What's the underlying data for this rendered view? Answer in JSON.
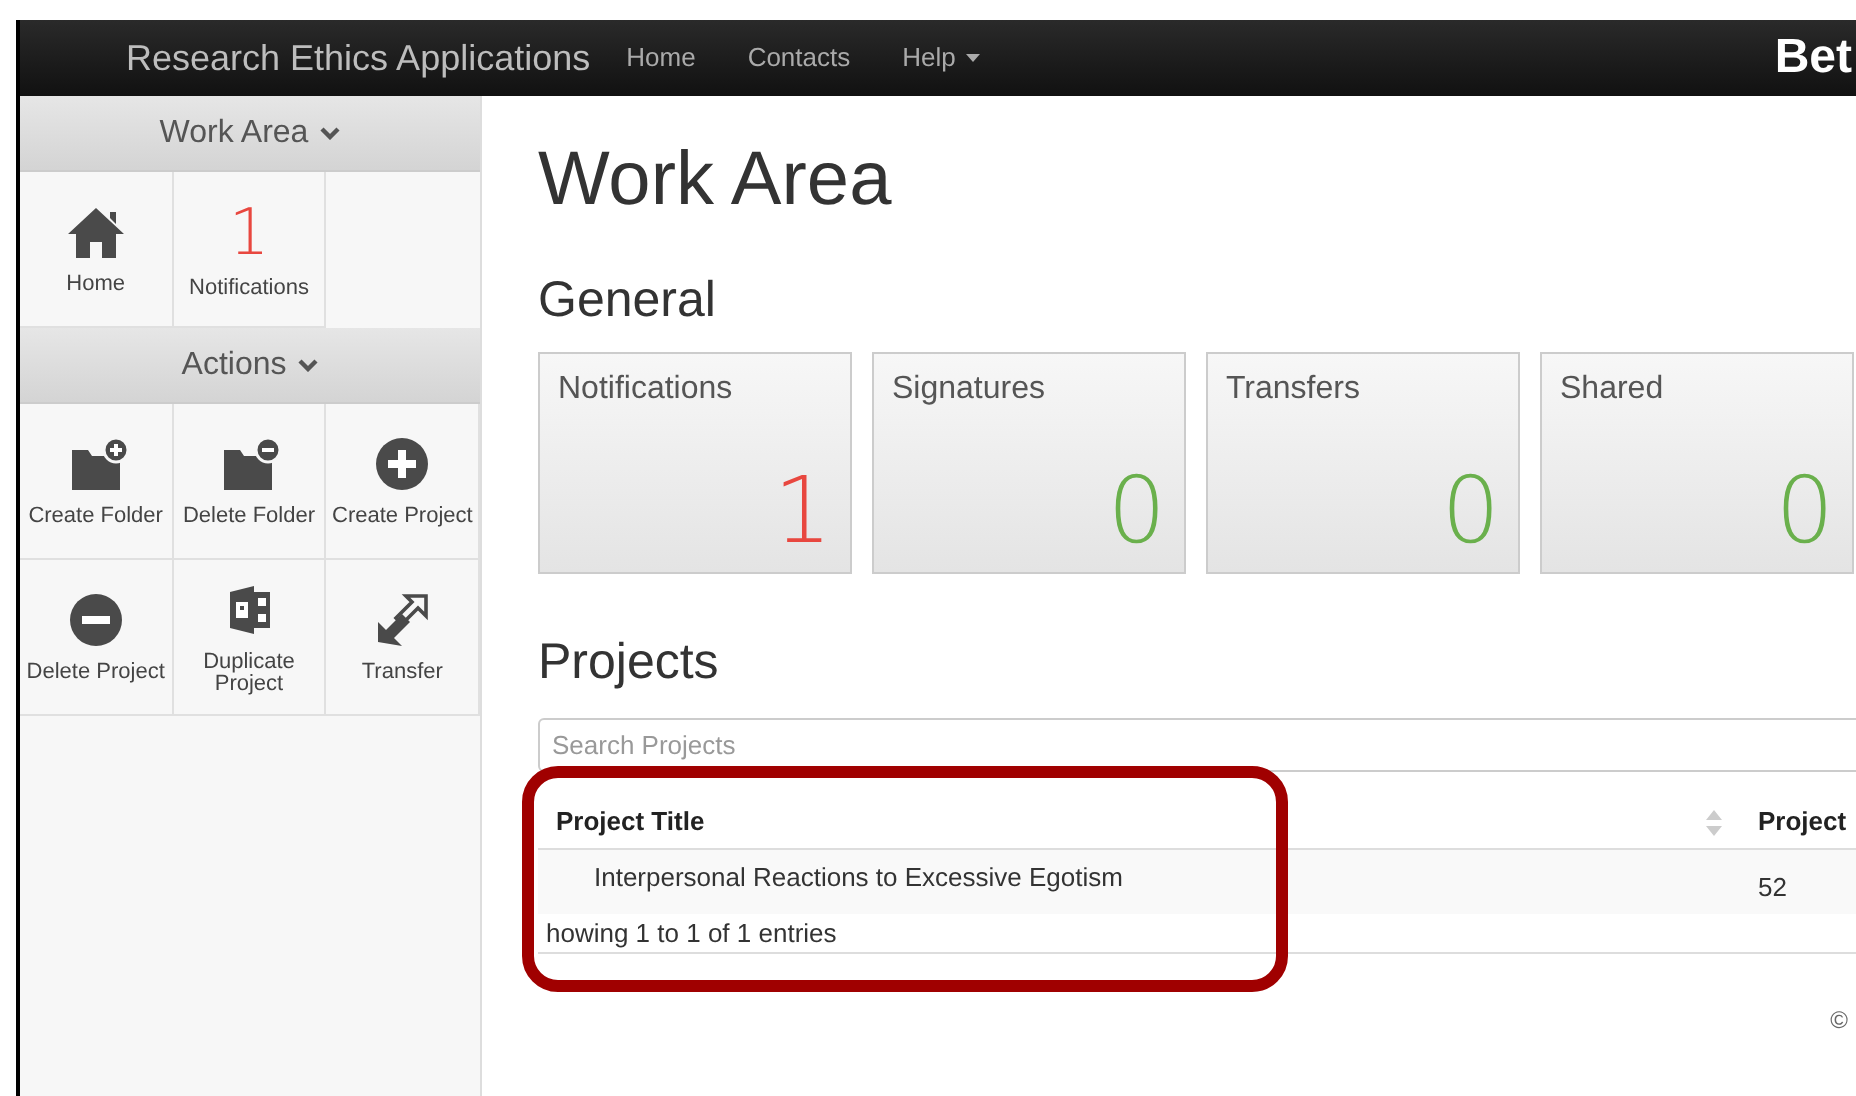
{
  "navbar": {
    "brand": "Research Ethics Applications",
    "links": [
      {
        "label": "Home",
        "dropdown": false
      },
      {
        "label": "Contacts",
        "dropdown": false
      },
      {
        "label": "Help",
        "dropdown": true
      }
    ],
    "right_text": "Bet"
  },
  "sidebar": {
    "sections": [
      {
        "title": "Work Area",
        "tiles": [
          {
            "kind": "icon",
            "label": "Home"
          },
          {
            "kind": "count",
            "count": "1",
            "label": "Notifications"
          }
        ]
      },
      {
        "title": "Actions",
        "tiles": [
          {
            "kind": "icon",
            "label": "Create Folder"
          },
          {
            "kind": "icon",
            "label": "Delete Folder"
          },
          {
            "kind": "icon",
            "label": "Create Project"
          },
          {
            "kind": "icon",
            "label": "Delete Project"
          },
          {
            "kind": "icon",
            "label": "Duplicate Project"
          },
          {
            "kind": "icon",
            "label": "Transfer"
          }
        ]
      }
    ]
  },
  "page_title": "Work Area",
  "general": {
    "title": "General",
    "cards": [
      {
        "title": "Notifications",
        "value": "1",
        "color": "#e8473f"
      },
      {
        "title": "Signatures",
        "value": "0",
        "color": "#6ab04c"
      },
      {
        "title": "Transfers",
        "value": "0",
        "color": "#6ab04c"
      },
      {
        "title": "Shared",
        "value": "0",
        "color": "#6ab04c"
      }
    ]
  },
  "projects": {
    "title": "Projects",
    "search": {
      "placeholder": "Search Projects"
    },
    "table": {
      "columns": [
        {
          "label": "Project Title",
          "sortable": true
        },
        {
          "label": "Project",
          "sortable": false
        }
      ],
      "rows": [
        {
          "cells": [
            "Interpersonal Reactions to Excessive Egotism",
            "52"
          ]
        }
      ]
    },
    "info": "howing 1 to 1 of 1 entries",
    "highlighted": true
  },
  "footer": {
    "text": "©"
  }
}
